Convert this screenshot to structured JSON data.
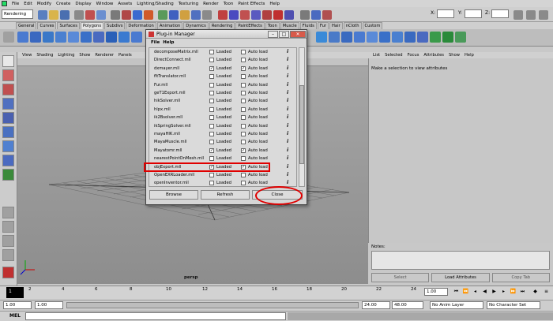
{
  "menubar": {
    "items": [
      "File",
      "Edit",
      "Modify",
      "Create",
      "Display",
      "Window",
      "Assets",
      "Lighting/Shading",
      "Texturing",
      "Render",
      "Toon",
      "Paint Effects",
      "Help"
    ]
  },
  "statusline": {
    "mode": "Rendering",
    "xyz": [
      "X:",
      "Y:",
      "Z:"
    ]
  },
  "shelf_tabs": [
    "General",
    "Curves",
    "Surfaces",
    "Polygons",
    "Subdivs",
    "Deformation",
    "Animation",
    "Dynamics",
    "Rendering",
    "PaintEffects",
    "Toon",
    "Muscle",
    "Fluids",
    "Fur",
    "Hair",
    "nCloth",
    "Custom"
  ],
  "shelf_active": "Polygons",
  "panel_menu": [
    "View",
    "Shading",
    "Lighting",
    "Show",
    "Renderer",
    "Panels"
  ],
  "viewport": {
    "camera": "persp"
  },
  "attribute_editor": {
    "menu": [
      "List",
      "Selected",
      "Focus",
      "Attributes",
      "Show",
      "Help"
    ],
    "message": "Make a selection to view attributes",
    "notes_label": "Notes:",
    "buttons": [
      "Select",
      "Load Attributes",
      "Copy Tab"
    ]
  },
  "timeslider": {
    "current_frame": "1",
    "ticks": [
      "2",
      "4",
      "6",
      "8",
      "10",
      "12",
      "14",
      "16",
      "18",
      "20",
      "22",
      "24"
    ],
    "time_field": "1.00"
  },
  "rangeslider": {
    "start": "1.00",
    "inner_start": "1.00",
    "inner_end": "24.00",
    "end": "48.00",
    "anim_layer": "No Anim Layer",
    "char_set": "No Character Set"
  },
  "cmdline": {
    "label": "MEL"
  },
  "dialog": {
    "title": "Plug-in Manager",
    "menu": [
      "File",
      "Help"
    ],
    "loaded_label": "Loaded",
    "autoload_label": "Auto load",
    "info_glyph": "i",
    "plugins": [
      {
        "name": "decomposeMatrix.mll",
        "loaded": false,
        "autoload": false
      },
      {
        "name": "DirectConnect.mll",
        "loaded": false,
        "autoload": false
      },
      {
        "name": "dxmayer.mll",
        "loaded": true,
        "autoload": true
      },
      {
        "name": "fltTranslator.mll",
        "loaded": false,
        "autoload": false
      },
      {
        "name": "Fur.mll",
        "loaded": false,
        "autoload": false
      },
      {
        "name": "geT1Export.mll",
        "loaded": false,
        "autoload": false
      },
      {
        "name": "hikSolver.mll",
        "loaded": false,
        "autoload": false
      },
      {
        "name": "hlpx.mll",
        "loaded": false,
        "autoload": false
      },
      {
        "name": "ik2Bsolver.mll",
        "loaded": false,
        "autoload": false
      },
      {
        "name": "ikSpringSolver.mll",
        "loaded": false,
        "autoload": false
      },
      {
        "name": "mayaHIK.mll",
        "loaded": false,
        "autoload": false
      },
      {
        "name": "MayaMuscle.mll",
        "loaded": false,
        "autoload": false
      },
      {
        "name": "Mayatomr.mll",
        "loaded": true,
        "autoload": true
      },
      {
        "name": "nearestPointOnMesh.mll",
        "loaded": false,
        "autoload": false
      },
      {
        "name": "objExport.mll",
        "loaded": true,
        "autoload": true
      },
      {
        "name": "OpenEXRLoader.mll",
        "loaded": false,
        "autoload": false
      },
      {
        "name": "openInventor.mll",
        "loaded": false,
        "autoload": false
      }
    ],
    "highlighted_plugin": "objExport.mll",
    "buttons": {
      "browse": "Browse",
      "refresh": "Refresh",
      "close": "Close"
    }
  },
  "colors": {
    "annotation": "#e00000",
    "viewport_top": "#a6a6a6",
    "viewport_bottom": "#8d8d8d"
  }
}
